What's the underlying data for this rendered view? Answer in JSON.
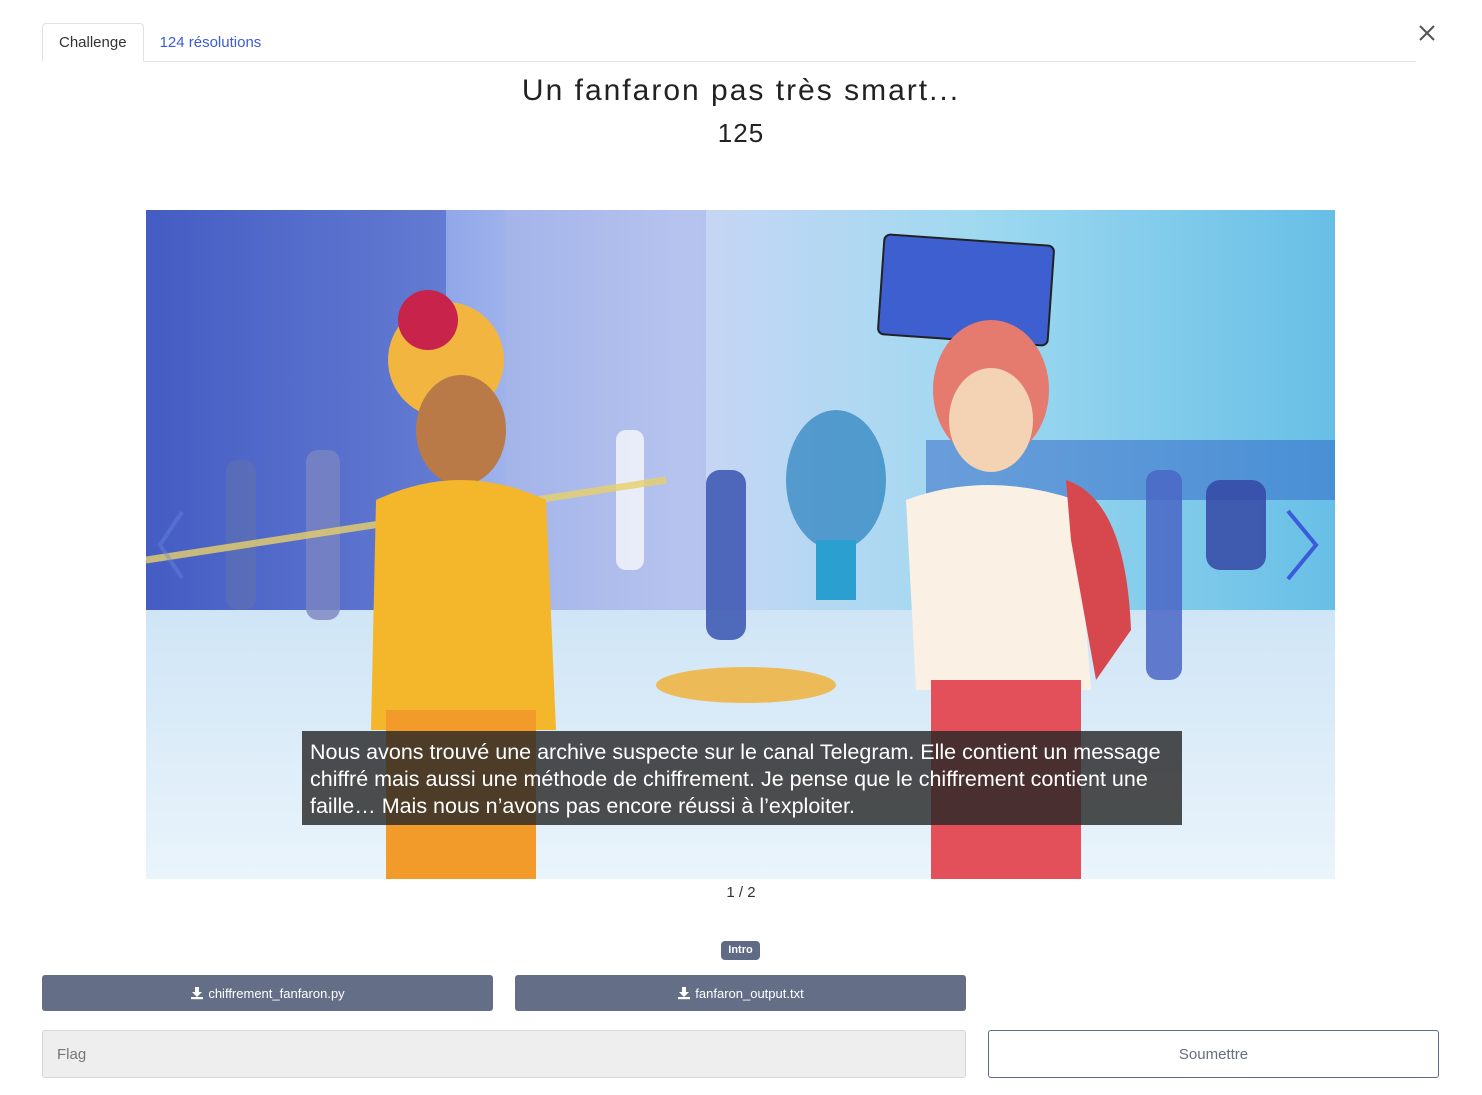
{
  "tabs": [
    {
      "label": "Challenge",
      "active": true
    },
    {
      "label": "124 résolutions",
      "active": false
    }
  ],
  "challenge": {
    "title": "Un fanfaron pas très smart...",
    "points": "125"
  },
  "carousel": {
    "caption": "Nous avons trouvé une archive suspecte sur le canal Telegram. Elle contient un message chiffré mais aussi une méthode de chiffrement. Je pense que le chiffrement contient une faille… Mais nous n’avons pas encore réussi à l’exploiter.",
    "counter": "1 / 2",
    "current_slide": 1,
    "total_slides": 2
  },
  "tag": "Intro",
  "files": [
    {
      "label": "chiffrement_fanfaron.py",
      "icon": "download-icon"
    },
    {
      "label": "fanfaron_output.txt",
      "icon": "download-icon"
    }
  ],
  "flag_input": {
    "placeholder": "Flag",
    "value": ""
  },
  "submit_label": "Soumettre",
  "colors": {
    "tab_link": "#3b5bdb",
    "button_bg": "#646e87",
    "badge_bg": "#5f6b85",
    "carousel_arrow": "#3b5bdb"
  }
}
